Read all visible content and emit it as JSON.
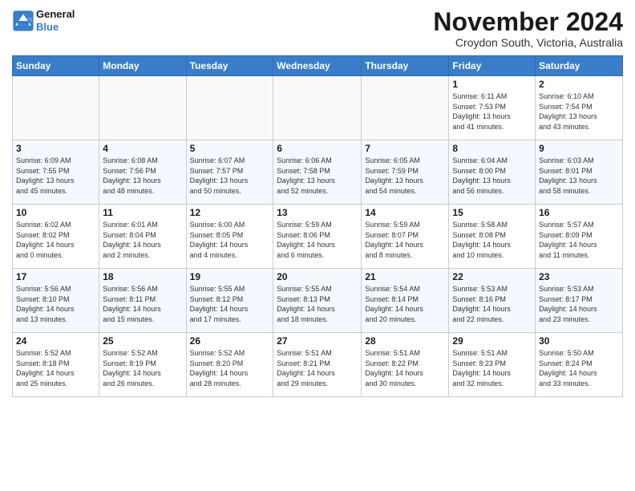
{
  "header": {
    "logo_line1": "General",
    "logo_line2": "Blue",
    "month": "November 2024",
    "location": "Croydon South, Victoria, Australia"
  },
  "weekdays": [
    "Sunday",
    "Monday",
    "Tuesday",
    "Wednesday",
    "Thursday",
    "Friday",
    "Saturday"
  ],
  "weeks": [
    [
      {
        "day": "",
        "info": ""
      },
      {
        "day": "",
        "info": ""
      },
      {
        "day": "",
        "info": ""
      },
      {
        "day": "",
        "info": ""
      },
      {
        "day": "",
        "info": ""
      },
      {
        "day": "1",
        "info": "Sunrise: 6:11 AM\nSunset: 7:53 PM\nDaylight: 13 hours\nand 41 minutes."
      },
      {
        "day": "2",
        "info": "Sunrise: 6:10 AM\nSunset: 7:54 PM\nDaylight: 13 hours\nand 43 minutes."
      }
    ],
    [
      {
        "day": "3",
        "info": "Sunrise: 6:09 AM\nSunset: 7:55 PM\nDaylight: 13 hours\nand 45 minutes."
      },
      {
        "day": "4",
        "info": "Sunrise: 6:08 AM\nSunset: 7:56 PM\nDaylight: 13 hours\nand 48 minutes."
      },
      {
        "day": "5",
        "info": "Sunrise: 6:07 AM\nSunset: 7:57 PM\nDaylight: 13 hours\nand 50 minutes."
      },
      {
        "day": "6",
        "info": "Sunrise: 6:06 AM\nSunset: 7:58 PM\nDaylight: 13 hours\nand 52 minutes."
      },
      {
        "day": "7",
        "info": "Sunrise: 6:05 AM\nSunset: 7:59 PM\nDaylight: 13 hours\nand 54 minutes."
      },
      {
        "day": "8",
        "info": "Sunrise: 6:04 AM\nSunset: 8:00 PM\nDaylight: 13 hours\nand 56 minutes."
      },
      {
        "day": "9",
        "info": "Sunrise: 6:03 AM\nSunset: 8:01 PM\nDaylight: 13 hours\nand 58 minutes."
      }
    ],
    [
      {
        "day": "10",
        "info": "Sunrise: 6:02 AM\nSunset: 8:02 PM\nDaylight: 14 hours\nand 0 minutes."
      },
      {
        "day": "11",
        "info": "Sunrise: 6:01 AM\nSunset: 8:04 PM\nDaylight: 14 hours\nand 2 minutes."
      },
      {
        "day": "12",
        "info": "Sunrise: 6:00 AM\nSunset: 8:05 PM\nDaylight: 14 hours\nand 4 minutes."
      },
      {
        "day": "13",
        "info": "Sunrise: 5:59 AM\nSunset: 8:06 PM\nDaylight: 14 hours\nand 6 minutes."
      },
      {
        "day": "14",
        "info": "Sunrise: 5:59 AM\nSunset: 8:07 PM\nDaylight: 14 hours\nand 8 minutes."
      },
      {
        "day": "15",
        "info": "Sunrise: 5:58 AM\nSunset: 8:08 PM\nDaylight: 14 hours\nand 10 minutes."
      },
      {
        "day": "16",
        "info": "Sunrise: 5:57 AM\nSunset: 8:09 PM\nDaylight: 14 hours\nand 11 minutes."
      }
    ],
    [
      {
        "day": "17",
        "info": "Sunrise: 5:56 AM\nSunset: 8:10 PM\nDaylight: 14 hours\nand 13 minutes."
      },
      {
        "day": "18",
        "info": "Sunrise: 5:56 AM\nSunset: 8:11 PM\nDaylight: 14 hours\nand 15 minutes."
      },
      {
        "day": "19",
        "info": "Sunrise: 5:55 AM\nSunset: 8:12 PM\nDaylight: 14 hours\nand 17 minutes."
      },
      {
        "day": "20",
        "info": "Sunrise: 5:55 AM\nSunset: 8:13 PM\nDaylight: 14 hours\nand 18 minutes."
      },
      {
        "day": "21",
        "info": "Sunrise: 5:54 AM\nSunset: 8:14 PM\nDaylight: 14 hours\nand 20 minutes."
      },
      {
        "day": "22",
        "info": "Sunrise: 5:53 AM\nSunset: 8:16 PM\nDaylight: 14 hours\nand 22 minutes."
      },
      {
        "day": "23",
        "info": "Sunrise: 5:53 AM\nSunset: 8:17 PM\nDaylight: 14 hours\nand 23 minutes."
      }
    ],
    [
      {
        "day": "24",
        "info": "Sunrise: 5:52 AM\nSunset: 8:18 PM\nDaylight: 14 hours\nand 25 minutes."
      },
      {
        "day": "25",
        "info": "Sunrise: 5:52 AM\nSunset: 8:19 PM\nDaylight: 14 hours\nand 26 minutes."
      },
      {
        "day": "26",
        "info": "Sunrise: 5:52 AM\nSunset: 8:20 PM\nDaylight: 14 hours\nand 28 minutes."
      },
      {
        "day": "27",
        "info": "Sunrise: 5:51 AM\nSunset: 8:21 PM\nDaylight: 14 hours\nand 29 minutes."
      },
      {
        "day": "28",
        "info": "Sunrise: 5:51 AM\nSunset: 8:22 PM\nDaylight: 14 hours\nand 30 minutes."
      },
      {
        "day": "29",
        "info": "Sunrise: 5:51 AM\nSunset: 8:23 PM\nDaylight: 14 hours\nand 32 minutes."
      },
      {
        "day": "30",
        "info": "Sunrise: 5:50 AM\nSunset: 8:24 PM\nDaylight: 14 hours\nand 33 minutes."
      }
    ]
  ]
}
